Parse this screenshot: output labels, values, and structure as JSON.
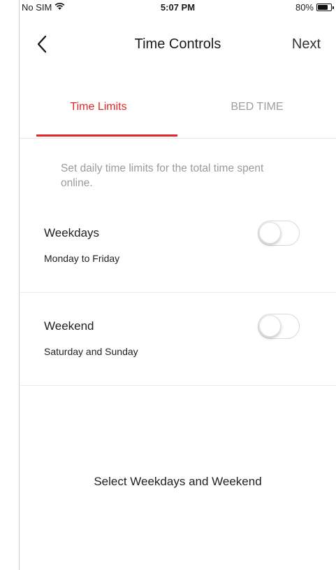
{
  "status_bar": {
    "carrier": "No SIM",
    "time": "5:07 PM",
    "battery_percent": "80%",
    "battery_level": 0.8
  },
  "nav": {
    "back_icon": "chevron-left-icon",
    "title": "Time Controls",
    "next_label": "Next"
  },
  "tabs": [
    {
      "label": "Time Limits",
      "active": true
    },
    {
      "label": "BED TIME",
      "active": false
    }
  ],
  "colors": {
    "accent": "#e3262b",
    "inactive_tab": "#9e9e9e"
  },
  "description": "Set daily time limits for the total time spent online.",
  "rows": [
    {
      "title": "Weekdays",
      "subtitle": "Monday to Friday",
      "enabled": false
    },
    {
      "title": "Weekend",
      "subtitle": "Saturday and Sunday",
      "enabled": false
    }
  ],
  "footer_text": "Select Weekdays and Weekend"
}
